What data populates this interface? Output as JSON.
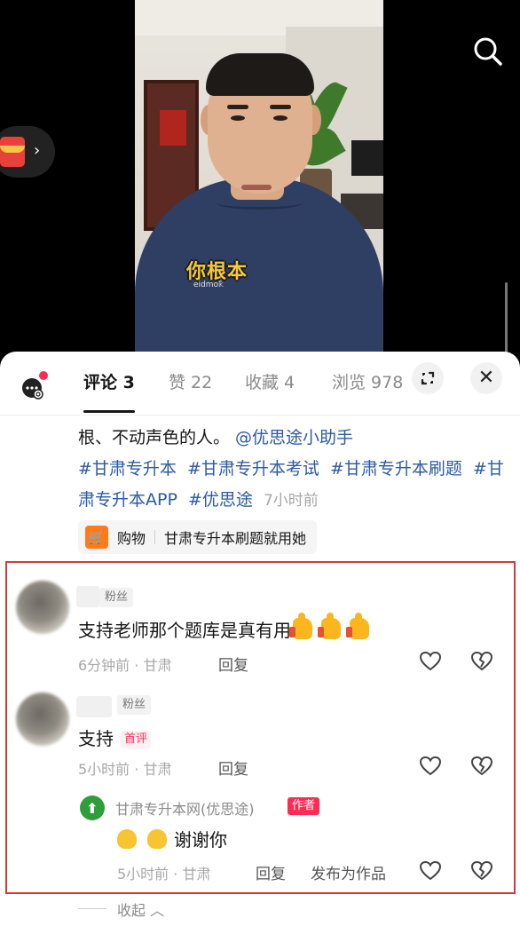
{
  "video": {
    "subtitle": "你根本",
    "shirt_badge": "eidmo𝕜̀"
  },
  "header_icons": {
    "search": "search-icon",
    "side_widget": "red-packet-icon"
  },
  "tabs": [
    {
      "label": "评论 3",
      "active": true
    },
    {
      "label": "赞 22",
      "active": false
    },
    {
      "label": "收藏 4",
      "active": false
    },
    {
      "label": "浏览 978",
      "active": false
    }
  ],
  "sheet_controls": {
    "close": "✕"
  },
  "description": {
    "text": "根、不动声色的人。",
    "mention": "@优思途小助手",
    "tags": [
      "#甘肃专升本",
      "#甘肃专升本考试",
      "#甘肃专升本刷题",
      "#甘肃专升本APP",
      "#优思途"
    ],
    "time": "7小时前"
  },
  "shop": {
    "label": "购物",
    "title": "甘肃专升本刷题就用她"
  },
  "comments": [
    {
      "badge": "粉丝",
      "text": "支持老师那个题库是真有用",
      "emoji_count": 3,
      "time": "6分钟前",
      "location": "甘肃",
      "reply": "回复"
    },
    {
      "badge": "粉丝",
      "text": "支持",
      "first_badge": "首评",
      "time": "5小时前",
      "location": "甘肃",
      "reply": "回复"
    }
  ],
  "author_reply": {
    "name": "甘肃专升本网(优思途)",
    "badge": "作者",
    "text": "谢谢你",
    "time": "5小时前",
    "location": "甘肃",
    "reply": "回复",
    "publish": "发布为作品"
  },
  "collapse_label": "收起",
  "colors": {
    "accent": "#fe2c55",
    "link": "#2c5aa0",
    "highlight_border": "#d33a3a"
  }
}
